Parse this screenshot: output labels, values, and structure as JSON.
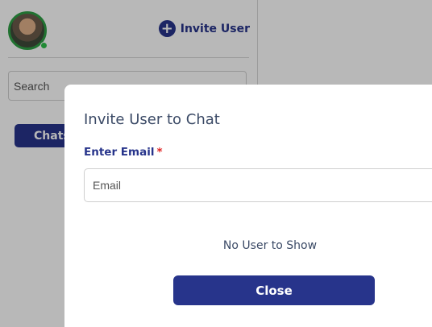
{
  "sidebar": {
    "invite_button_label": "Invite User",
    "search_placeholder": "Search",
    "chats_tab_label": "Chats"
  },
  "modal": {
    "title": "Invite User to Chat",
    "email_label": "Enter Email",
    "required_mark": "*",
    "email_placeholder": "Email",
    "empty_message": "No User to Show",
    "close_label": "Close"
  },
  "colors": {
    "accent": "#27348b",
    "required": "#e02424",
    "online": "#2fbf4a"
  },
  "icons": {
    "invite": "plus-circle-icon"
  }
}
